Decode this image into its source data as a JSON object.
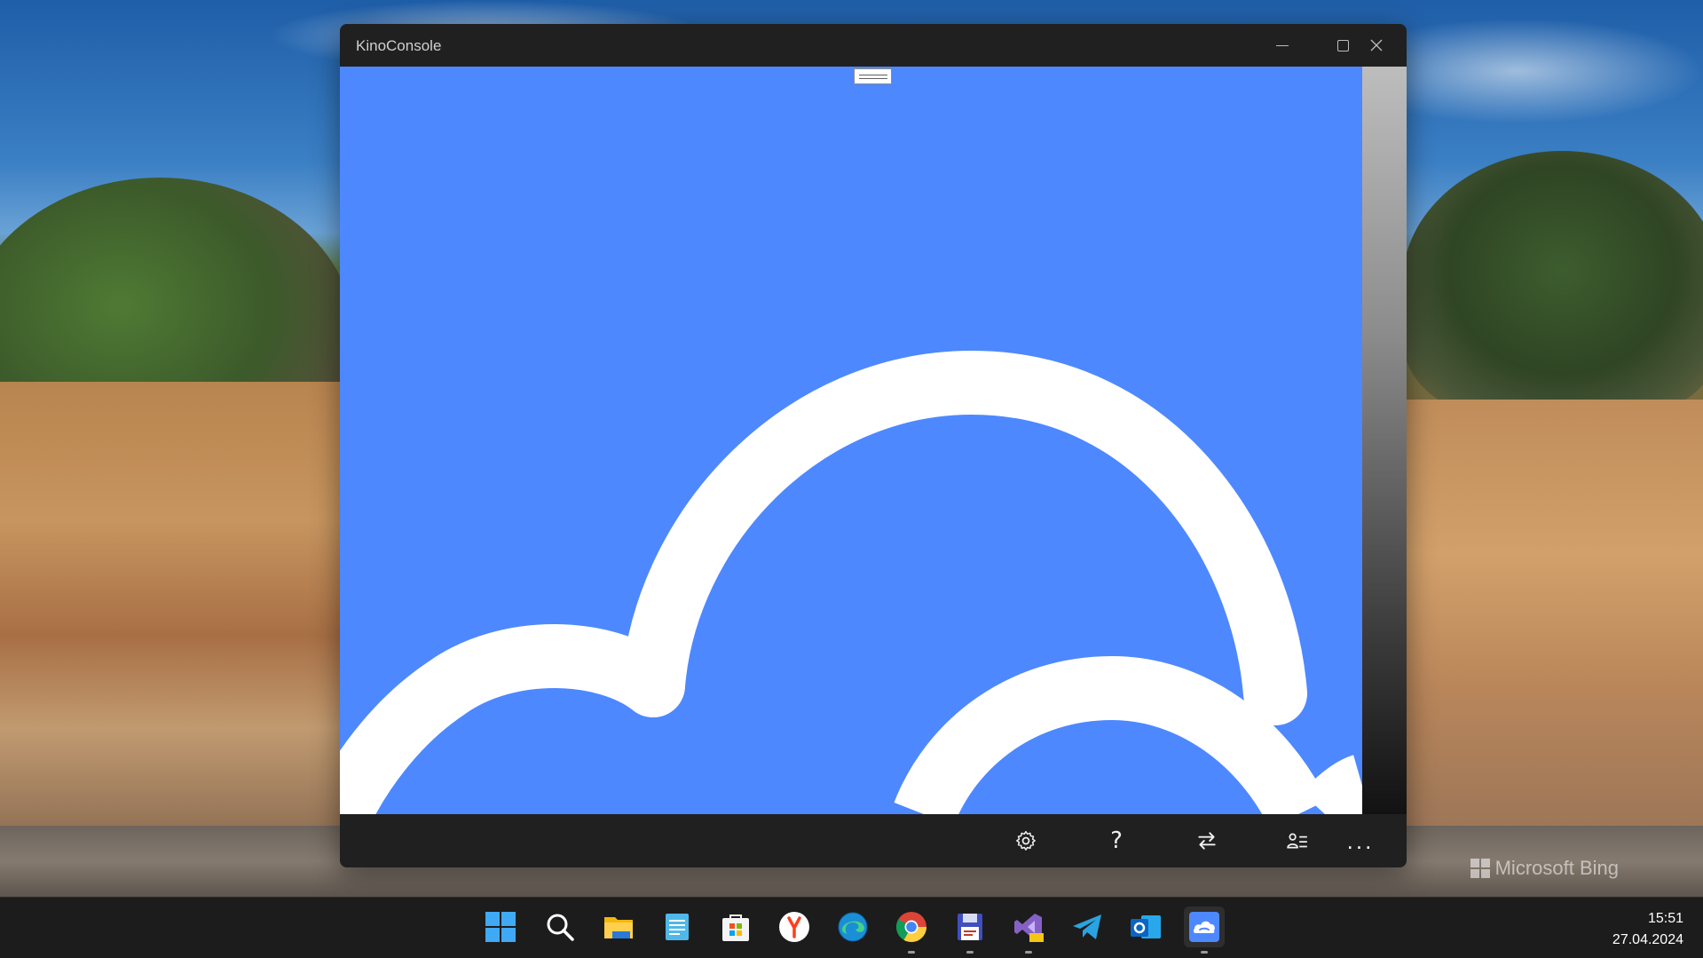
{
  "window": {
    "title": "KinoConsole",
    "controls": [
      "minimize-icon",
      "maximize-icon",
      "close-icon"
    ]
  },
  "content": {
    "background_color": "#4d88ff",
    "logo_color": "#ffffff",
    "logo": "cloud-gamepad-logo"
  },
  "commandbar": {
    "items": [
      {
        "name": "settings",
        "icon": "gear-icon"
      },
      {
        "name": "help",
        "icon": "question-icon",
        "glyph": "?"
      },
      {
        "name": "switch",
        "icon": "switch-arrows-icon"
      },
      {
        "name": "users",
        "icon": "user-list-icon"
      },
      {
        "name": "more",
        "icon": "more-icon",
        "glyph": "..."
      }
    ]
  },
  "desktop": {
    "watermark": "Microsoft Bing"
  },
  "taskbar": {
    "apps": [
      {
        "name": "start",
        "icon": "windows-start-icon"
      },
      {
        "name": "search",
        "icon": "search-icon"
      },
      {
        "name": "file-explorer",
        "icon": "folder-icon"
      },
      {
        "name": "notepad",
        "icon": "notepad-icon"
      },
      {
        "name": "microsoft-store",
        "icon": "store-icon"
      },
      {
        "name": "yandex-browser",
        "icon": "yandex-icon"
      },
      {
        "name": "edge",
        "icon": "edge-icon"
      },
      {
        "name": "chrome",
        "icon": "chrome-icon",
        "running": true
      },
      {
        "name": "save-app",
        "icon": "floppy-icon",
        "running": true
      },
      {
        "name": "visual-studio-preview",
        "icon": "visual-studio-icon",
        "running": true
      },
      {
        "name": "telegram",
        "icon": "telegram-icon"
      },
      {
        "name": "outlook",
        "icon": "outlook-icon"
      },
      {
        "name": "kinoconsole",
        "icon": "cloud-gamepad-icon",
        "running": true
      }
    ],
    "clock": {
      "time": "15:51",
      "date": "27.04.2024"
    }
  }
}
